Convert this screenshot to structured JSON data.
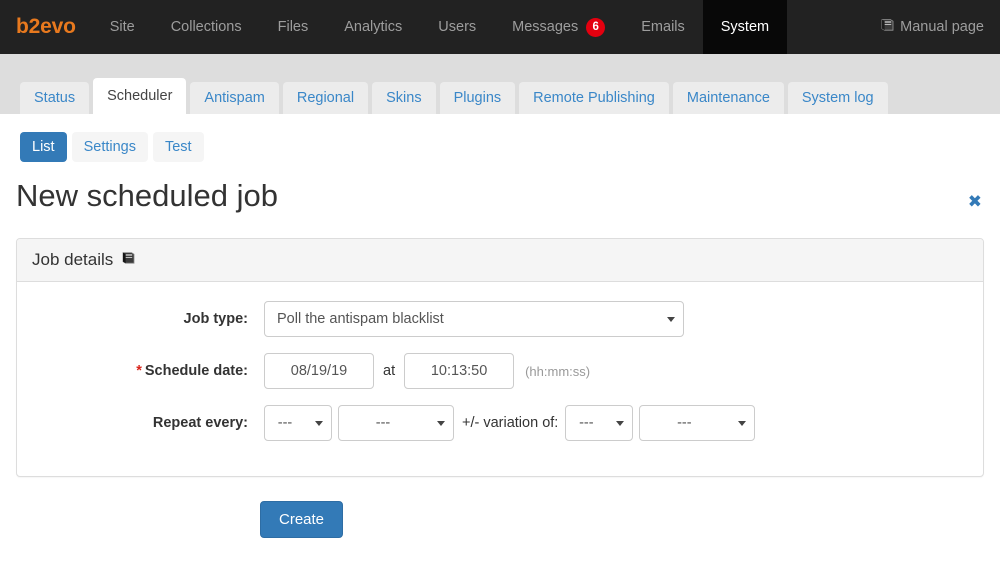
{
  "navbar": {
    "brand": "b2evo",
    "items": [
      {
        "label": "Site",
        "active": false
      },
      {
        "label": "Collections",
        "active": false
      },
      {
        "label": "Files",
        "active": false
      },
      {
        "label": "Analytics",
        "active": false
      },
      {
        "label": "Users",
        "active": false
      },
      {
        "label": "Messages",
        "active": false,
        "badge": "6"
      },
      {
        "label": "Emails",
        "active": false
      },
      {
        "label": "System",
        "active": true
      }
    ],
    "manual_label": "Manual page",
    "manual_icon": "book-icon",
    "badge_color": "#e4000f",
    "brand_color": "#e8791e"
  },
  "tabs": [
    {
      "label": "Status",
      "active": false
    },
    {
      "label": "Scheduler",
      "active": true
    },
    {
      "label": "Antispam",
      "active": false
    },
    {
      "label": "Regional",
      "active": false
    },
    {
      "label": "Skins",
      "active": false
    },
    {
      "label": "Plugins",
      "active": false
    },
    {
      "label": "Remote Publishing",
      "active": false
    },
    {
      "label": "Maintenance",
      "active": false
    },
    {
      "label": "System log",
      "active": false
    }
  ],
  "subtabs": [
    {
      "label": "List",
      "active": true
    },
    {
      "label": "Settings",
      "active": false
    },
    {
      "label": "Test",
      "active": false
    }
  ],
  "page": {
    "title": "New scheduled job",
    "close_icon": "close-icon"
  },
  "panel": {
    "heading": "Job details",
    "heading_icon": "book-icon"
  },
  "form": {
    "job_type": {
      "label": "Job type:",
      "value": "Poll the antispam blacklist"
    },
    "schedule_date": {
      "required_marker": "*",
      "label": "Schedule date:",
      "date_value": "08/19/19",
      "at_label": "at",
      "time_value": "10:13:50",
      "hint": "(hh:mm:ss)"
    },
    "repeat": {
      "label": "Repeat every:",
      "every_number": "---",
      "every_unit": "---",
      "variation_label": "+/- variation of:",
      "variation_number": "---",
      "variation_unit": "---"
    },
    "submit_label": "Create",
    "accent_color": "#337ab7"
  }
}
